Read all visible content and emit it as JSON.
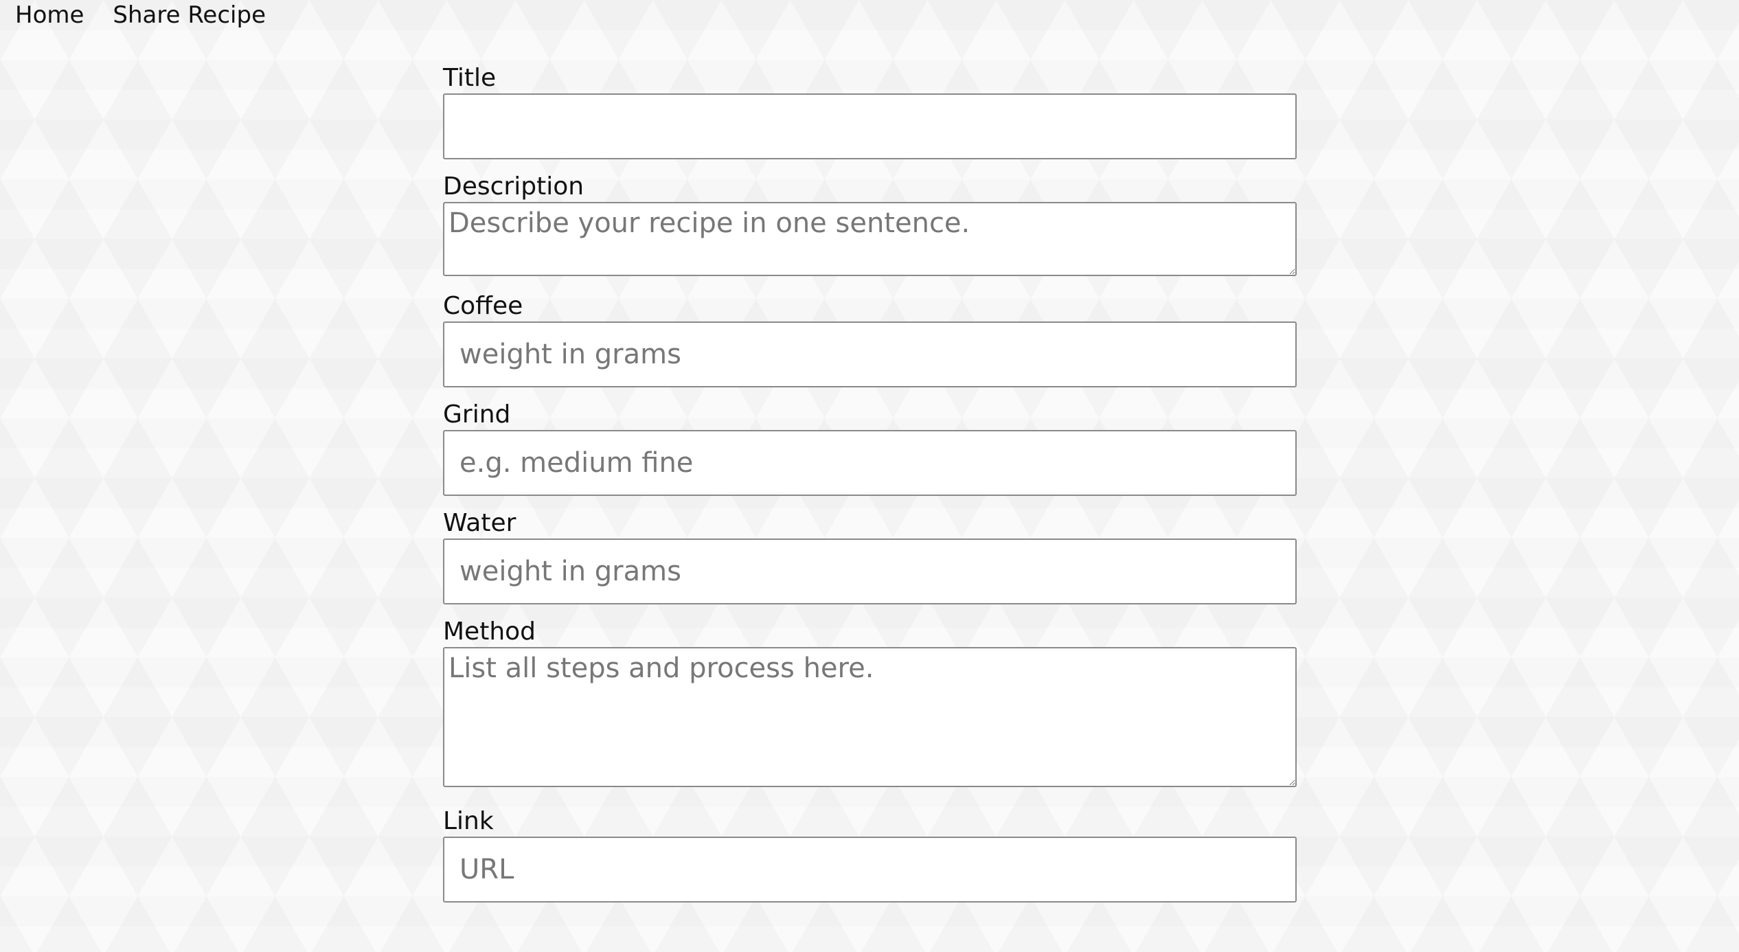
{
  "nav": {
    "home": "Home",
    "share_recipe": "Share Recipe"
  },
  "form": {
    "title": {
      "label": "Title",
      "placeholder": ""
    },
    "description": {
      "label": "Description",
      "placeholder": "Describe your recipe in one sentence."
    },
    "coffee": {
      "label": "Coffee",
      "placeholder": "weight in grams"
    },
    "grind": {
      "label": "Grind",
      "placeholder": "e.g. medium fine"
    },
    "water": {
      "label": "Water",
      "placeholder": "weight in grams"
    },
    "method": {
      "label": "Method",
      "placeholder": "List all steps and process here."
    },
    "link": {
      "label": "Link",
      "placeholder": "URL"
    }
  }
}
